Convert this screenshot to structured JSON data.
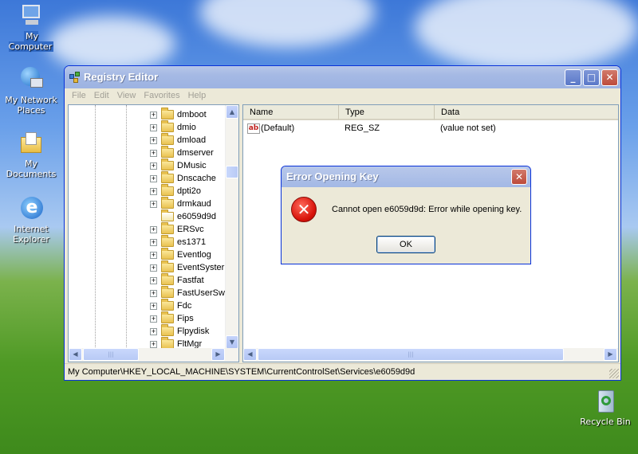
{
  "desktop": {
    "icons": [
      {
        "label": "My Computer",
        "icon": "my-computer-icon"
      },
      {
        "label": "My Network Places",
        "icon": "network-places-icon"
      },
      {
        "label": "My Documents",
        "icon": "my-documents-icon"
      },
      {
        "label": "Internet Explorer",
        "icon": "internet-explorer-icon"
      },
      {
        "label": "Recycle Bin",
        "icon": "recycle-bin-icon"
      }
    ]
  },
  "window": {
    "title": "Registry Editor",
    "buttons": {
      "minimize": "_",
      "maximize": "□",
      "close": "✕"
    },
    "menu": [
      "File",
      "Edit",
      "View",
      "Favorites",
      "Help"
    ],
    "tree": {
      "items": [
        {
          "label": "dmboot",
          "expander": true
        },
        {
          "label": "dmio",
          "expander": true
        },
        {
          "label": "dmload",
          "expander": true
        },
        {
          "label": "dmserver",
          "expander": true
        },
        {
          "label": "DMusic",
          "expander": true
        },
        {
          "label": "Dnscache",
          "expander": true
        },
        {
          "label": "dpti2o",
          "expander": true
        },
        {
          "label": "drmkaud",
          "expander": true
        },
        {
          "label": "e6059d9d",
          "expander": false
        },
        {
          "label": "ERSvc",
          "expander": true
        },
        {
          "label": "es1371",
          "expander": true
        },
        {
          "label": "Eventlog",
          "expander": true
        },
        {
          "label": "EventSyster",
          "expander": true
        },
        {
          "label": "Fastfat",
          "expander": true
        },
        {
          "label": "FastUserSw",
          "expander": true
        },
        {
          "label": "Fdc",
          "expander": true
        },
        {
          "label": "Fips",
          "expander": true
        },
        {
          "label": "Flpydisk",
          "expander": true
        },
        {
          "label": "FltMgr",
          "expander": true
        }
      ]
    },
    "list": {
      "columns": [
        "Name",
        "Type",
        "Data"
      ],
      "rows": [
        {
          "name": "(Default)",
          "type": "REG_SZ",
          "data": "(value not set)"
        }
      ]
    },
    "statusbar": "My Computer\\HKEY_LOCAL_MACHINE\\SYSTEM\\CurrentControlSet\\Services\\e6059d9d"
  },
  "dialog": {
    "title": "Error Opening Key",
    "message": "Cannot open e6059d9d:  Error while opening key.",
    "ok_label": "OK",
    "close_label": "✕"
  },
  "colors": {
    "accent": "#0831d9",
    "titlebar_inactive": "#9db3e2",
    "error_red": "#d8130b"
  }
}
